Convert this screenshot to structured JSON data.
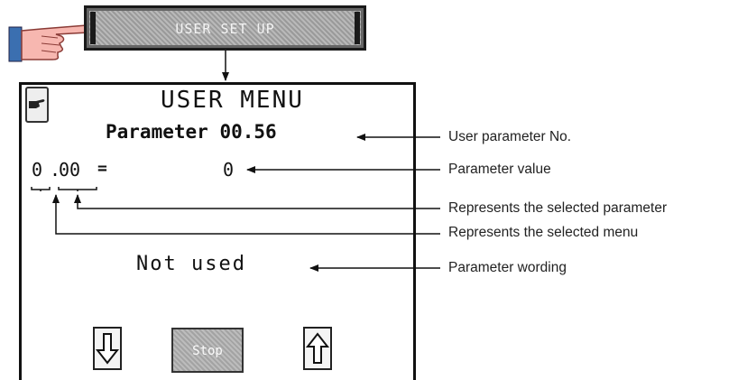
{
  "setup_button": {
    "label": "USER SET UP"
  },
  "screen": {
    "title": "USER MENU",
    "parameter_prefix": "Parameter",
    "parameter_number": "00.56",
    "menu_digit": "0",
    "separator": ".",
    "parameter_digits": "00",
    "equals": "=",
    "value": "0",
    "wording": "Not used",
    "stop_label": "Stop"
  },
  "annotations": {
    "user_parameter_no": "User parameter No.",
    "parameter_value": "Parameter value",
    "selected_parameter": "Represents the selected parameter",
    "selected_menu": "Represents the selected menu",
    "parameter_wording": "Parameter wording"
  },
  "icons": [
    "pointing-hand-icon",
    "hand-icon",
    "arrow-down-icon",
    "arrow-up-icon"
  ]
}
